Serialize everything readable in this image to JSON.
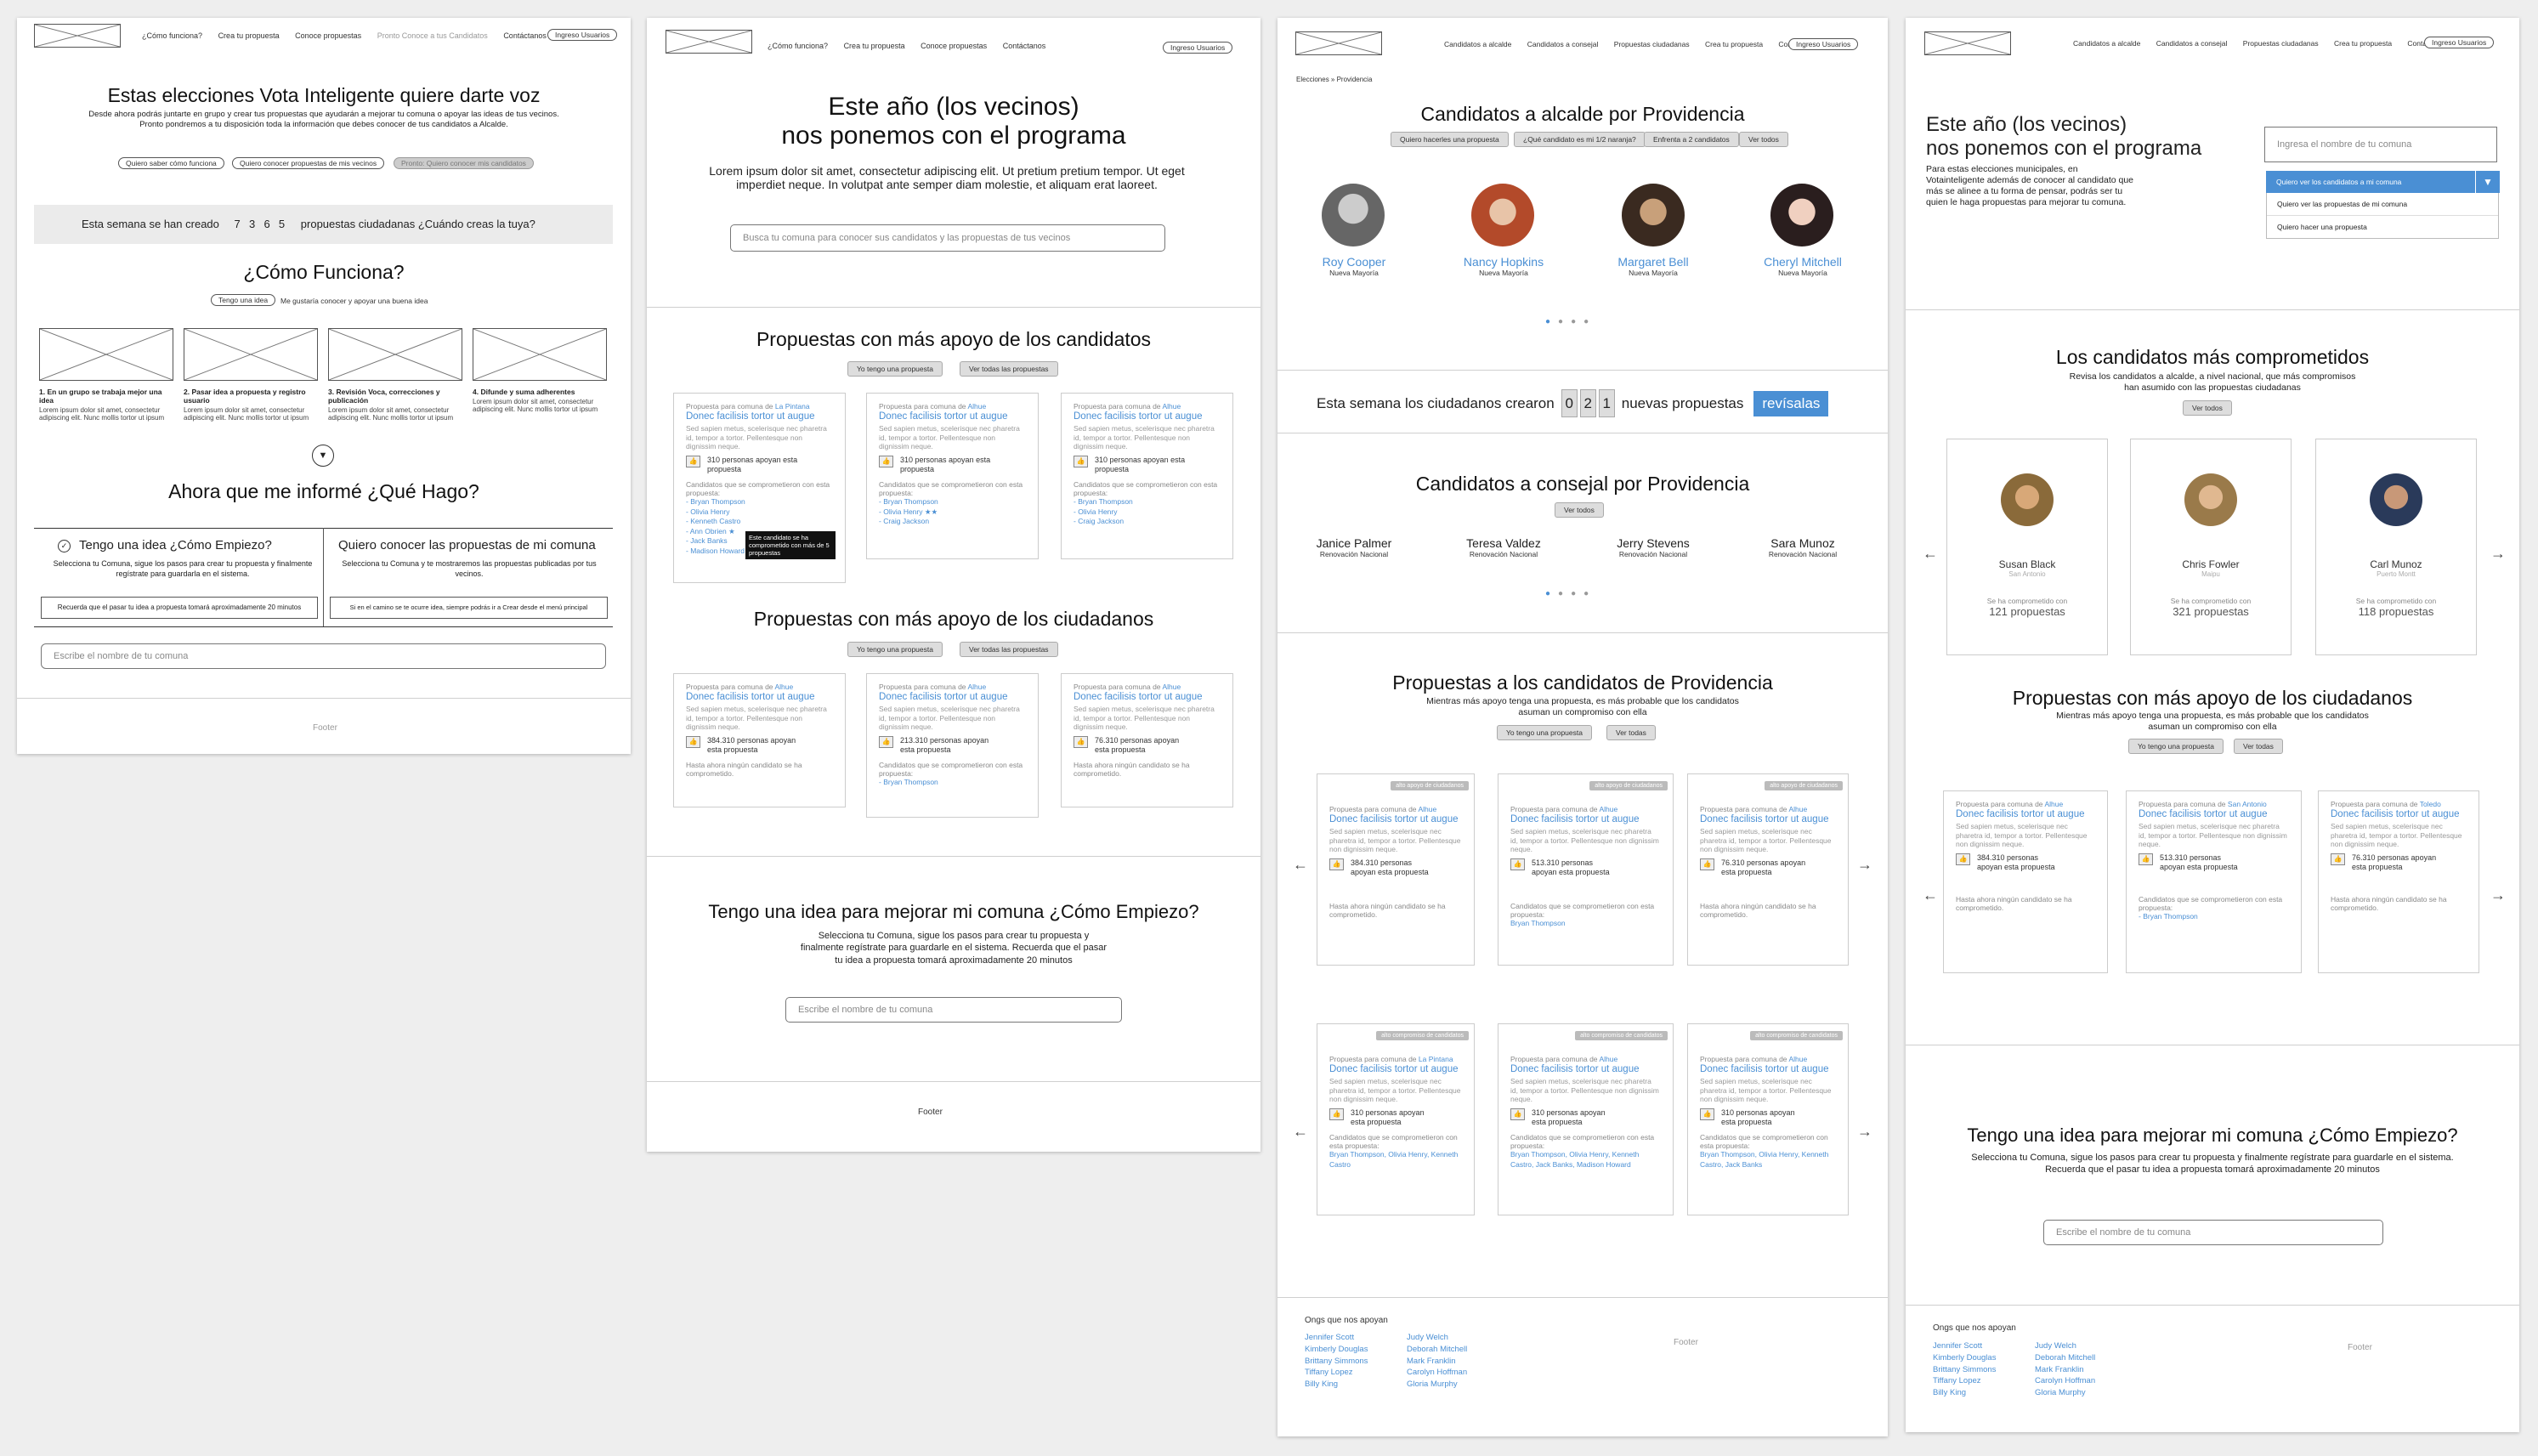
{
  "p1": {
    "nav": [
      "¿Cómo funciona?",
      "Crea tu propuesta",
      "Conoce propuestas",
      "Pronto Conoce a tus Candidatos",
      "Contáctanos"
    ],
    "login": "Ingreso Usuarios",
    "hero_title": "Estas elecciones Vota Inteligente quiere darte voz",
    "hero_text": "Desde ahora podrás juntarte en grupo y crear tus propuestas que ayudarán a mejorar tu comuna o apoyar las ideas de tus vecinos. Pronto pondremos a tu disposición toda la información que debes conocer de tus candidatos a Alcalde.",
    "hero_btns": [
      "Quiero saber cómo funciona",
      "Quiero conocer propuestas de mis vecinos",
      "Pronto: Quiero conocer mis candidatos"
    ],
    "counter_pre": "Esta semana se han creado",
    "counter_digits": [
      "7",
      "3",
      "6",
      "5"
    ],
    "counter_post": "propuestas ciudadanas ¿Cuándo creas la tuya?",
    "how_title": "¿Cómo Funciona?",
    "how_pill": "Tengo una idea",
    "how_pill_text": "Me gustaría conocer y apoyar una buena idea",
    "steps": [
      {
        "title": "1. En un grupo se trabaja mejor una idea",
        "text": "Lorem ipsum dolor sit amet, consectetur adipiscing elit. Nunc mollis tortor ut ipsum"
      },
      {
        "title": "2. Pasar idea a propuesta y registro usuario",
        "text": "Lorem ipsum dolor sit amet, consectetur adipiscing elit. Nunc mollis tortor ut ipsum"
      },
      {
        "title": "3. Revisión Voca, correcciones y publicación",
        "text": "Lorem ipsum dolor sit amet, consectetur adipiscing elit. Nunc mollis tortor ut ipsum"
      },
      {
        "title": "4. Difunde y suma adherentes",
        "text": "Lorem ipsum dolor sit amet, consectetur adipiscing elit. Nunc mollis tortor ut ipsum"
      }
    ],
    "now_title": "Ahora que me informé ¿Qué Hago?",
    "col1_title": "Tengo una idea ¿Cómo Empiezo?",
    "col1_text": "Selecciona tu Comuna, sigue los pasos para crear tu propuesta y finalmente regístrate para guardarla en el sistema.",
    "col1_box": "Recuerda que el pasar tu idea a propuesta tomará aproximadamente 20 minutos",
    "col2_title": "Quiero conocer las propuestas de mi comuna",
    "col2_text": "Selecciona tu Comuna y te mostraremos las propuestas publicadas por tus vecinos.",
    "col2_box": "Si en el camino se te ocurre idea, siempre podrás ir a Crear desde el menú principal",
    "search_placeholder": "Escribe el nombre de tu comuna",
    "footer": "Footer"
  },
  "p2": {
    "nav": [
      "¿Cómo funciona?",
      "Crea tu propuesta",
      "Conoce propuestas",
      "Contáctanos"
    ],
    "login": "Ingreso Usuarios",
    "hero_title_1": "Este año (los vecinos)",
    "hero_title_2": "nos ponemos con el programa",
    "hero_text": "Lorem ipsum dolor sit amet, consectetur adipiscing elit. Ut pretium pretium tempor. Ut eget imperdiet neque. In volutpat ante semper diam molestie, et aliquam erat laoreet.",
    "search_placeholder": "Busca tu comuna para conocer sus candidatos y las propuestas de tus vecinos",
    "sec1_title": "Propuestas con más apoyo de los candidatos",
    "sec1_btns": [
      "Yo tengo una propuesta",
      "Ver todas las propuestas"
    ],
    "sec1_cards": [
      {
        "comuna": "La Pintana",
        "votes": "310 personas apoyan esta propuesta",
        "cands": [
          "Bryan Thompson",
          "Olivia Henry",
          "Kenneth Castro",
          "Ann Obrien",
          "Jack Banks",
          "Madison Howard"
        ]
      },
      {
        "comuna": "Alhue",
        "votes": "310 personas apoyan esta propuesta",
        "cands": [
          "Bryan Thompson",
          "Olivia Henry",
          "Craig Jackson"
        ]
      },
      {
        "comuna": "Alhue",
        "votes": "310 personas apoyan esta propuesta",
        "cands": [
          "Bryan Thompson",
          "Olivia Henry",
          "Craig Jackson"
        ]
      }
    ],
    "tooltip": "Este candidato se ha comprometido con más de 5 propuestas",
    "sec2_title": "Propuestas con más apoyo de los ciudadanos",
    "sec2_btns": [
      "Yo tengo una propuesta",
      "Ver todas las propuestas"
    ],
    "sec2_cards": [
      {
        "comuna": "Alhue",
        "votes": "384.310 personas apoyan esta propuesta",
        "note": "Hasta ahora ningún candidato se ha comprometido.",
        "cands": []
      },
      {
        "comuna": "Alhue",
        "votes": "213.310 personas apoyan esta propuesta",
        "note": "Candidatos que se comprometieron con esta propuesta:",
        "cands": [
          "Bryan Thompson"
        ]
      },
      {
        "comuna": "Alhue",
        "votes": "76.310 personas apoyan esta propuesta",
        "note": "Hasta ahora ningún candidato se ha comprometido.",
        "cands": []
      }
    ],
    "idea_title": "Tengo una idea para mejorar mi comuna ¿Cómo Empiezo?",
    "idea_text": "Selecciona tu Comuna, sigue los pasos para crear tu propuesta y finalmente regístrate para guardarle en el sistema. Recuerda que el pasar tu idea a propuesta tomará aproximadamente 20 minutos",
    "idea_placeholder": "Escribe el nombre de tu comuna",
    "footer": "Footer"
  },
  "card_common": {
    "prefix": "Propuesta para comuna de",
    "title": "Donec facilisis tortor ut augue",
    "lorem": "Sed sapien metus, scelerisque nec pharetra id, tempor a tortor. Pellentesque non dignissim neque.",
    "cands_label": "Candidatos que se comprometieron con esta propuesta:"
  },
  "p3": {
    "nav": [
      "Candidatos a alcalde",
      "Candidatos a consejal",
      "Propuestas ciudadanas",
      "Crea tu propuesta",
      "Contáctanos"
    ],
    "login": "Ingreso Usuarios",
    "breadcrumb": [
      "Elecciones",
      "Providencia"
    ],
    "alc_title": "Candidatos a alcalde por Providencia",
    "alc_btns": [
      "Quiero hacerles una propuesta",
      "¿Qué candidato es mi 1/2 naranja?",
      "Enfrenta a 2 candidatos",
      "Ver todos"
    ],
    "alcaldes": [
      {
        "name": "Roy Cooper",
        "party": "Nueva Mayoría"
      },
      {
        "name": "Nancy Hopkins",
        "party": "Nueva Mayoría"
      },
      {
        "name": "Margaret Bell",
        "party": "Nueva Mayoría"
      },
      {
        "name": "Cheryl Mitchell",
        "party": "Nueva Mayoría"
      }
    ],
    "counter_pre": "Esta semana los ciudadanos crearon",
    "counter_digits": [
      "0",
      "2",
      "1"
    ],
    "counter_post": "nuevas propuestas",
    "counter_btn": "revísalas",
    "con_title": "Candidatos a consejal por Providencia",
    "con_btn": "Ver todos",
    "concejales": [
      {
        "name": "Janice Palmer",
        "party": "Renovación Nacional"
      },
      {
        "name": "Teresa Valdez",
        "party": "Renovación Nacional"
      },
      {
        "name": "Jerry Stevens",
        "party": "Renovación Nacional"
      },
      {
        "name": "Sara Munoz",
        "party": "Renovación Nacional"
      }
    ],
    "prop_title": "Propuestas a los candidatos de Providencia",
    "prop_text": "Mientras más apoyo tenga una propuesta, es más probable que los candidatos asuman un compromiso con ella",
    "prop_btns": [
      "Yo tengo una propuesta",
      "Ver todas"
    ],
    "row1_tag": "alto apoyo de ciudadanos",
    "row1": [
      {
        "comuna": "Alhue",
        "votes": "384.310 personas apoyan esta propuesta",
        "note": "Hasta ahora ningún candidato se ha comprometido.",
        "cands": ""
      },
      {
        "comuna": "Alhue",
        "votes": "513.310 personas apoyan esta propuesta",
        "note": "Candidatos que se comprometieron con esta propuesta:",
        "cands": "Bryan Thompson"
      },
      {
        "comuna": "Alhue",
        "votes": "76.310 personas apoyan esta propuesta",
        "note": "Hasta ahora ningún candidato se ha comprometido.",
        "cands": ""
      }
    ],
    "row2_tag": "alto compromiso de candidatos",
    "row2": [
      {
        "comuna": "La Pintana",
        "votes": "310 personas apoyan esta propuesta",
        "note": "Candidatos que se comprometieron con esta propuesta:",
        "cands": "Bryan Thompson, Olivia Henry, Kenneth Castro"
      },
      {
        "comuna": "Alhue",
        "votes": "310 personas apoyan esta propuesta",
        "note": "Candidatos que se comprometieron con esta propuesta:",
        "cands": "Bryan Thompson, Olivia Henry, Kenneth Castro, Jack Banks, Madison Howard"
      },
      {
        "comuna": "Alhue",
        "votes": "310 personas apoyan esta propuesta",
        "note": "Candidatos que se comprometieron con esta propuesta:",
        "cands": "Bryan Thompson, Olivia Henry, Kenneth Castro, Jack Banks"
      }
    ],
    "ngo_title": "Ongs que nos apoyan",
    "ngo_col1": [
      "Jennifer Scott",
      "Kimberly Douglas",
      "Brittany Simmons",
      "Tiffany Lopez",
      "Billy King"
    ],
    "ngo_col2": [
      "Judy Welch",
      "Deborah Mitchell",
      "Mark Franklin",
      "Carolyn Hoffman",
      "Gloria Murphy"
    ],
    "footer": "Footer"
  },
  "p4": {
    "nav": [
      "Candidatos a alcalde",
      "Candidatos a consejal",
      "Propuestas ciudadanas",
      "Crea tu propuesta",
      "Contáctanos"
    ],
    "login": "Ingreso Usuarios",
    "hero_title_1": "Este año (los vecinos)",
    "hero_title_2": "nos ponemos con el programa",
    "hero_text": "Para estas elecciones municipales, en Votainteligente además de conocer al candidato que más se alinee a tu forma de pensar, podrás ser tu quien le haga propuestas para mejorar tu comuna.",
    "comuna_placeholder": "Ingresa el nombre de tu comuna",
    "dropdown_selected": "Quiero ver los candidatos a mi comuna",
    "dropdown_options": [
      "Quiero ver las propuestas de mi comuna",
      "Quiero hacer una propuesta"
    ],
    "comp_title": "Los candidatos más comprometidos",
    "comp_text": "Revisa los candidatos a alcalde, a nivel nacional, que más compromisos han asumido con las propuestas ciudadanas",
    "comp_btn": "Ver todos",
    "comp_cands": [
      {
        "name": "Susan Black",
        "comuna": "San Antonio",
        "label": "Se ha comprometido con",
        "count": "121 propuestas"
      },
      {
        "name": "Chris Fowler",
        "comuna": "Maipu",
        "label": "Se ha comprometido con",
        "count": "321 propuestas"
      },
      {
        "name": "Carl Munoz",
        "comuna": "Puerto Montt",
        "label": "Se ha comprometido con",
        "count": "118 propuestas"
      }
    ],
    "cit_title": "Propuestas con más apoyo de los ciudadanos",
    "cit_text": "Mientras más apoyo tenga una propuesta, es más probable que los candidatos asuman un compromiso con ella",
    "cit_btns": [
      "Yo tengo una propuesta",
      "Ver todas"
    ],
    "cit_cards": [
      {
        "comuna": "Alhue",
        "votes": "384.310 personas apoyan esta propuesta",
        "note": "Hasta ahora ningún candidato se ha comprometido.",
        "cands": ""
      },
      {
        "comuna": "San Antonio",
        "votes": "513.310 personas apoyan esta propuesta",
        "note": "Candidatos que se comprometieron con esta propuesta:",
        "cands": "Bryan Thompson"
      },
      {
        "comuna": "Toledo",
        "votes": "76.310 personas apoyan esta propuesta",
        "note": "Hasta ahora ningún candidato se ha comprometido.",
        "cands": ""
      }
    ],
    "idea_title": "Tengo una idea para mejorar mi comuna ¿Cómo Empiezo?",
    "idea_text": "Selecciona tu Comuna, sigue los pasos para crear tu propuesta y finalmente regístrate para guardarle en el sistema. Recuerda que el pasar tu idea a propuesta tomará aproximadamente 20 minutos",
    "idea_placeholder": "Escribe el nombre de tu comuna",
    "ngo_title": "Ongs que nos apoyan",
    "ngo_col1": [
      "Jennifer Scott",
      "Kimberly Douglas",
      "Brittany Simmons",
      "Tiffany Lopez",
      "Billy King"
    ],
    "ngo_col2": [
      "Judy Welch",
      "Deborah Mitchell",
      "Mark Franklin",
      "Carolyn Hoffman",
      "Gloria Murphy"
    ],
    "footer": "Footer"
  },
  "colors": {
    "accent": "#4a8fd4",
    "page_bg": "#eeeeee",
    "counter_btn": "#4a8fd4"
  }
}
